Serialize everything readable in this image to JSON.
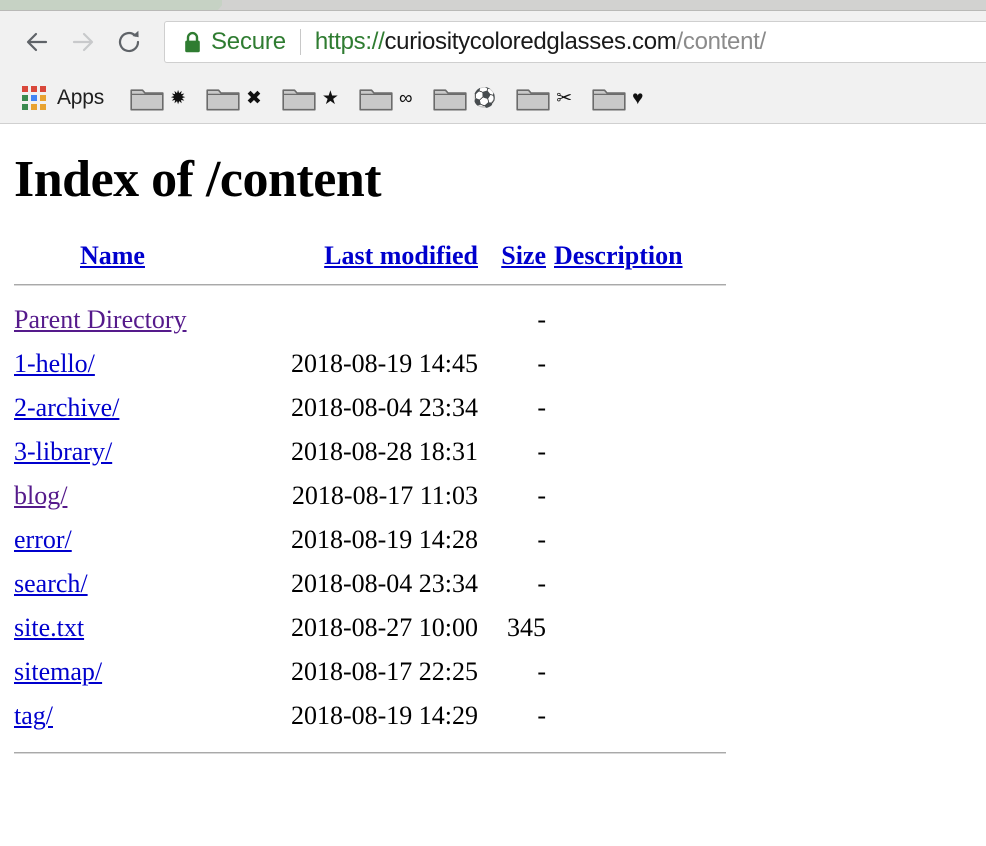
{
  "browser": {
    "tab_active": true,
    "back_label": "Back",
    "forward_label": "Forward",
    "reload_label": "Reload",
    "security": {
      "badge_text": "Secure",
      "icon": "lock-icon",
      "color": "#2f7c31"
    },
    "url": {
      "scheme": "https://",
      "host": "curiositycoloredglasses.com",
      "path": "/content/",
      "full": "https://curiositycoloredglasses.com/content/"
    },
    "bookmarks": {
      "apps_label": "Apps",
      "apps_colors": [
        "#d9483b",
        "#d9483b",
        "#d9483b",
        "#3a8a4f",
        "#4285f4",
        "#e8a331",
        "#3a8a4f",
        "#e8a331",
        "#e8a331"
      ],
      "folders": [
        {
          "name": "bookmark-folder-1",
          "glyph": "✹"
        },
        {
          "name": "bookmark-folder-2",
          "glyph": "✖"
        },
        {
          "name": "bookmark-folder-3",
          "glyph": "★"
        },
        {
          "name": "bookmark-folder-4",
          "glyph": "∞"
        },
        {
          "name": "bookmark-folder-5",
          "glyph": "⚽"
        },
        {
          "name": "bookmark-folder-6",
          "glyph": "✂"
        },
        {
          "name": "bookmark-folder-7",
          "glyph": "♥"
        }
      ]
    }
  },
  "page": {
    "title": "Index of /content",
    "columns": {
      "name": "Name",
      "last_modified": "Last modified",
      "size": "Size",
      "description": "Description"
    },
    "entries": [
      {
        "name": "Parent Directory",
        "visited": true,
        "last_modified": "",
        "size": "-",
        "description": ""
      },
      {
        "name": "1-hello/",
        "visited": false,
        "last_modified": "2018-08-19 14:45",
        "size": "-",
        "description": ""
      },
      {
        "name": "2-archive/",
        "visited": false,
        "last_modified": "2018-08-04 23:34",
        "size": "-",
        "description": ""
      },
      {
        "name": "3-library/",
        "visited": false,
        "last_modified": "2018-08-28 18:31",
        "size": "-",
        "description": ""
      },
      {
        "name": "blog/",
        "visited": true,
        "last_modified": "2018-08-17 11:03",
        "size": "-",
        "description": ""
      },
      {
        "name": "error/",
        "visited": false,
        "last_modified": "2018-08-19 14:28",
        "size": "-",
        "description": ""
      },
      {
        "name": "search/",
        "visited": false,
        "last_modified": "2018-08-04 23:34",
        "size": "-",
        "description": ""
      },
      {
        "name": "site.txt",
        "visited": false,
        "last_modified": "2018-08-27 10:00",
        "size": "345",
        "description": ""
      },
      {
        "name": "sitemap/",
        "visited": false,
        "last_modified": "2018-08-17 22:25",
        "size": "-",
        "description": ""
      },
      {
        "name": "tag/",
        "visited": false,
        "last_modified": "2018-08-19 14:29",
        "size": "-",
        "description": ""
      }
    ]
  },
  "colors": {
    "link": "#0000cd",
    "visited_link": "#551a8b",
    "secure_green": "#2f7c31",
    "chrome_bg": "#f1f1f1"
  }
}
